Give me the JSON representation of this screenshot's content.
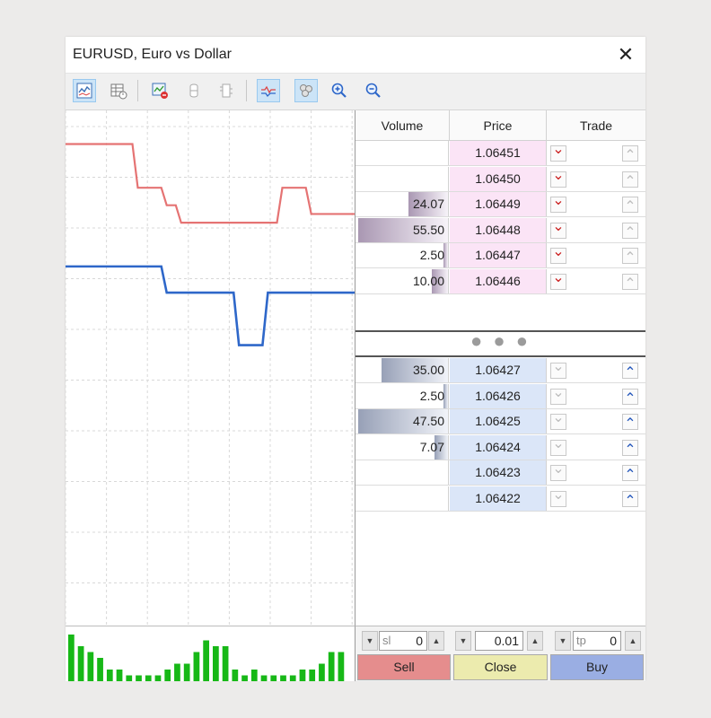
{
  "window": {
    "title": "EURUSD, Euro vs  Dollar",
    "close_glyph": "✕"
  },
  "toolbar": {
    "icons": [
      "tick-chart-icon",
      "table-icon",
      "chart-sell-icon",
      "cylinder-icon",
      "depth-icon",
      "chart-line-icon",
      "circles-icon",
      "zoom-in-icon",
      "zoom-out-icon"
    ]
  },
  "book": {
    "headers": {
      "volume": "Volume",
      "price": "Price",
      "trade": "Trade"
    },
    "asks": [
      {
        "volume": "",
        "price": "1.06451",
        "bar": 0
      },
      {
        "volume": "",
        "price": "1.06450",
        "bar": 0
      },
      {
        "volume": "24.07",
        "price": "1.06449",
        "bar": 0.44
      },
      {
        "volume": "55.50",
        "price": "1.06448",
        "bar": 1.0
      },
      {
        "volume": "2.50",
        "price": "1.06447",
        "bar": 0.05
      },
      {
        "volume": "10.00",
        "price": "1.06446",
        "bar": 0.18
      }
    ],
    "bids": [
      {
        "volume": "35.00",
        "price": "1.06427",
        "bar": 0.74
      },
      {
        "volume": "2.50",
        "price": "1.06426",
        "bar": 0.05
      },
      {
        "volume": "47.50",
        "price": "1.06425",
        "bar": 1.0
      },
      {
        "volume": "7.07",
        "price": "1.06424",
        "bar": 0.15
      },
      {
        "volume": "",
        "price": "1.06423",
        "bar": 0
      },
      {
        "volume": "",
        "price": "1.06422",
        "bar": 0
      }
    ],
    "middle_dots": "● ● ●"
  },
  "controls": {
    "sl": {
      "label": "sl",
      "value": "0"
    },
    "volume": {
      "value": "0.01"
    },
    "tp": {
      "label": "tp",
      "value": "0"
    },
    "sell_label": "Sell",
    "close_label": "Close",
    "buy_label": "Buy",
    "sell_color": "#e58d8d",
    "close_color": "#ecebae",
    "buy_color": "#9aaee3"
  },
  "colors": {
    "ask_line": "#e57373",
    "bid_line": "#2e67c9",
    "volume_bars": "#17b817"
  },
  "chart_data": {
    "type": "line",
    "series": [
      {
        "values": [
          1.06451,
          1.06451,
          1.06451,
          1.06451,
          1.06451,
          1.06446,
          1.06446,
          1.06444,
          1.06442,
          1.06442,
          1.06442,
          1.06442,
          1.06442,
          1.06442,
          1.06442,
          1.06446,
          1.06446,
          1.06443,
          1.06443,
          1.06443,
          1.06443
        ]
      },
      {
        "values": [
          1.06437,
          1.06437,
          1.06437,
          1.06437,
          1.06437,
          1.06437,
          1.06437,
          1.06434,
          1.06434,
          1.06434,
          1.06434,
          1.06434,
          1.06428,
          1.06428,
          1.06434,
          1.06434,
          1.06434,
          1.06434,
          1.06434,
          1.06434,
          1.06434
        ]
      }
    ],
    "volume_bars": [
      8,
      6,
      5,
      4,
      2,
      2,
      1,
      1,
      1,
      1,
      2,
      3,
      3,
      5,
      7,
      6,
      6,
      2,
      1,
      2,
      1,
      1,
      1,
      1,
      2,
      2,
      3,
      5,
      5
    ]
  }
}
